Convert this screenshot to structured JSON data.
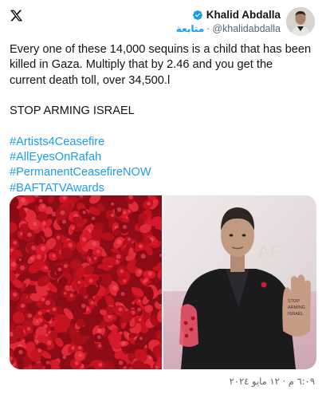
{
  "author": {
    "name": "Khalid Abdalla",
    "handle": "@khalidabdalla",
    "follow_label": "متابعة",
    "separator": "·"
  },
  "tweet": {
    "lines": [
      "Every one of these 14,000 sequins is a child that has been",
      "killed in Gaza. Multiply that by 2.46 and you get the",
      "current death toll, over 34,500.l"
    ],
    "headline": "STOP ARMING ISRAEL",
    "hashtags": [
      "#Artists4Ceasefire",
      "#AllEyesOnRafah",
      "#PermanentCeasefireNOW",
      "#BAFTATVAwards"
    ]
  },
  "media": {
    "photos": [
      {
        "subject": "red sequins closeup"
      },
      {
        "subject": "man holding bag of red sequins",
        "hand_text": "STOP ARMING ISRAEL"
      }
    ]
  },
  "timestamp": "٦:٠٩ م · ١٢ مايو ٢٠٢٤",
  "colors": {
    "accent": "#1d9bf0",
    "text": "#0f1419",
    "muted": "#536471",
    "sequin_red": "#b0101f"
  },
  "icons": {
    "logo": "x-logo-icon",
    "verified": "verified-badge-icon"
  }
}
